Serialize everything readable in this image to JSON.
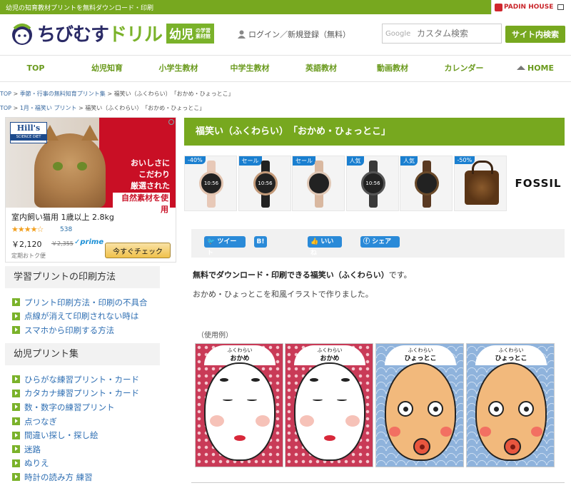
{
  "topbar": {
    "tagline": "幼児の知育教材プリントを無料ダウンロード・印刷",
    "partner": "PADIN HOUSE"
  },
  "header": {
    "logo_main": "ちびむす",
    "logo_accent": "ドリル",
    "logo_badge": "幼児",
    "logo_badge_sub": "の学習素材館",
    "login": "ログイン／新規登録（無料）",
    "search_label": "Google",
    "search_placeholder": "カスタム検索",
    "search_button": "サイト内検索"
  },
  "nav": [
    "TOP",
    "幼児知育",
    "小学生教材",
    "中学生教材",
    "英語教材",
    "動画教材",
    "カレンダー",
    "HOME"
  ],
  "breadcrumbs": [
    {
      "links": [
        "TOP",
        "季節・行事の無料知育プリント集"
      ],
      "current": "福笑い（ふくわらい）　「おかめ・ひょっとこ」"
    },
    {
      "links": [
        "TOP",
        "1月・福笑い プリント"
      ],
      "current": "福笑い（ふくわらい）　「おかめ・ひょっとこ」"
    }
  ],
  "ad_left": {
    "brand": "Hill's",
    "brand_sub": "SCIENCE DIET",
    "copy_line1": "おいしさに",
    "copy_line2": "こだわり",
    "copy_line3": "厳選された",
    "copy_line4": "自然素材を使用",
    "product": "室内飼い猫用 1歳以上 2.8kg",
    "stars": "★★★★☆",
    "rating_count": "538",
    "price": "￥2,120",
    "old_price": "￥2,355",
    "prime": "✓prime",
    "shipping": "定期おトク便",
    "cta": "今すぐチェック"
  },
  "sidebar": {
    "section1_title": "学習プリントの印刷方法",
    "section1_items": [
      "プリント印刷方法・印刷の不具合",
      "点線が消えて印刷されない時は",
      "スマホから印刷する方法"
    ],
    "section2_title": "幼児プリント集",
    "section2_items": [
      "ひらがな練習プリント・カード",
      "カタカナ練習プリント・カード",
      "数・数字の練習プリント",
      "点つなぎ",
      "間違い探し・探し絵",
      "迷路",
      "ぬりえ",
      "時計の読み方 練習"
    ]
  },
  "main": {
    "title": "福笑い（ふくわらい）　「おかめ・ひょっとこ」",
    "watch_ad": {
      "tags": [
        "-40%",
        "セール",
        "セール",
        "人気",
        "人気",
        "-50%"
      ],
      "watch_time": "10:56",
      "brand": "FOSSIL",
      "band_colors": [
        "#e8c9b8",
        "#222222",
        "#d9b8a0",
        "#3a3a3a",
        "#5a3a22"
      ],
      "bezel_colors": [
        "#e2c4b0",
        "#c49b7a",
        "#e0c8b6",
        "#555555",
        "#6a4a2a"
      ]
    },
    "share": {
      "tweet": "ツイート",
      "hatena": "B!",
      "like": "いいね",
      "share": "シェア"
    },
    "desc_bold": "無料でダウンロード・印刷できる福笑い（ふくわらい）",
    "desc_tail": "です。",
    "desc2": "おかめ・ひょっとこを和風イラストで作りました。",
    "usage_label": "（使用例）",
    "cards": [
      {
        "small": "ふくわらい",
        "big": "おかめ"
      },
      {
        "small": "ふくわらい",
        "big": "おかめ"
      },
      {
        "small": "ふくわらい",
        "big": "ひょっとこ"
      },
      {
        "small": "ふくわらい",
        "big": "ひょっとこ"
      }
    ]
  }
}
